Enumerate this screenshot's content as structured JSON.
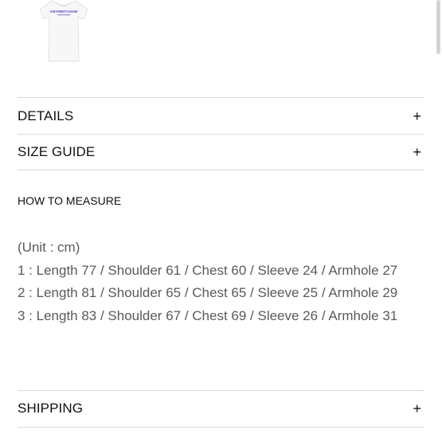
{
  "product": {
    "thumb_print": "ANYRBITCHOW"
  },
  "sections": {
    "details": {
      "label": "DETAILS",
      "toggle": "+"
    },
    "size_guide": {
      "label": "SIZE GUIDE",
      "toggle": "+"
    },
    "shipping": {
      "label": "SHIPPING",
      "toggle": "+"
    }
  },
  "measure": {
    "heading": "HOW TO MEASURE",
    "unit": "(Unit : cm)",
    "rows": [
      "1 : Length 77 / Shoulder 61 / Chest 60 / Sleeve 24 / Armhole 27",
      "2 : Length 81 / Shoulder 65 / Chest 65 / Sleeve 25 / Armhole 29",
      "3 : Length 83 / Shoulder 67 / Chest 69 / Sleeve 26 / Armhole 31"
    ]
  },
  "colors": {
    "print": "#5b4ad6",
    "divider": "#d9d9d9",
    "body_text": "#5a5a5a"
  }
}
